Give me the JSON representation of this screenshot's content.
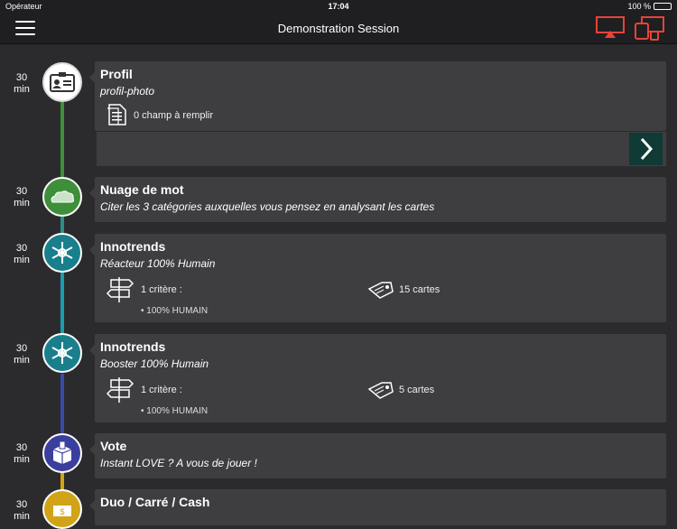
{
  "status": {
    "carrier": "Opérateur",
    "time": "17:04",
    "battery": "100 %",
    "battery_level": 1.0
  },
  "header": {
    "title": "Demonstration Session"
  },
  "colors": {
    "accent": "#e8433a",
    "profile": "#ffffff",
    "word_cloud": "#3f8f3a",
    "innotrends": "#1a7f8c",
    "vote": "#3a3f9e",
    "duo": "#d1a317"
  },
  "steps": [
    {
      "duration": "30",
      "unit": "min",
      "title": "Profil",
      "subtitle": "profil-photo",
      "meta": "0 champ à remplir",
      "icon": "id-card-icon"
    },
    {
      "duration": "30",
      "unit": "min",
      "title": "Nuage de mot",
      "subtitle": "Citer les 3 catégories auxquelles vous pensez en analysant les cartes",
      "icon": "word-cloud-icon"
    },
    {
      "duration": "30",
      "unit": "min",
      "title": "Innotrends",
      "subtitle": "Réacteur 100% Humain",
      "criteria": "1 critère :",
      "criteria_item": "• 100% HUMAIN",
      "cards": "15 cartes",
      "icon": "snowflake-icon"
    },
    {
      "duration": "30",
      "unit": "min",
      "title": "Innotrends",
      "subtitle": "Booster 100% Humain",
      "criteria": "1 critère :",
      "criteria_item": "• 100% HUMAIN",
      "cards": "5 cartes",
      "icon": "snowflake-icon"
    },
    {
      "duration": "30",
      "unit": "min",
      "title": "Vote",
      "subtitle": "Instant LOVE ? A vous de jouer !",
      "icon": "ballot-box-icon"
    },
    {
      "duration": "30",
      "unit": "min",
      "title": "Duo / Carré / Cash",
      "icon": "cash-icon"
    }
  ]
}
